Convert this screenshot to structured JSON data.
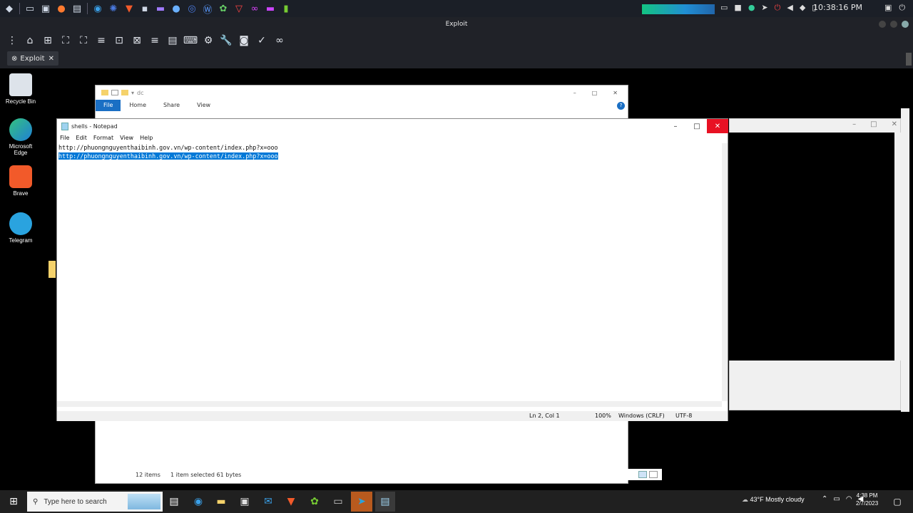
{
  "kali_panel": {
    "clock": "10:38:16 PM",
    "icons": [
      "kali-menu-icon",
      "workspace-icon",
      "files-icon",
      "firefox-icon",
      "terminal-icon",
      "edge-icon",
      "app-icon",
      "brave-icon",
      "app-icon",
      "app-icon",
      "app-icon",
      "app-icon",
      "app-icon",
      "app-icon",
      "app-icon"
    ]
  },
  "viewer": {
    "title": "Exploit",
    "tab_label": "Exploit",
    "tab_close": "✕"
  },
  "desktop_icons": [
    {
      "label": "Recycle Bin"
    },
    {
      "label": "Microsoft Edge"
    },
    {
      "label": "Brave"
    },
    {
      "label": "Telegram"
    }
  ],
  "explorer": {
    "path_text": "dc",
    "ribbon_tabs": [
      "File",
      "Home",
      "Share",
      "View"
    ],
    "status_items": "12 items",
    "status_selected": "1 item selected  61 bytes"
  },
  "notepad": {
    "title": "shells - Notepad",
    "menu": [
      "File",
      "Edit",
      "Format",
      "View",
      "Help"
    ],
    "lines": [
      "http://phuongnguyenthaibinh.gov.vn/wp-content/index.php?x=ooo",
      "http://phuongnguyenthaibinh.gov.vn/wp-content/index.php?x=ooo"
    ],
    "status": {
      "position": "Ln 2, Col 1",
      "zoom": "100%",
      "line_ending": "Windows (CRLF)",
      "encoding": "UTF-8"
    }
  },
  "taskbar": {
    "search_placeholder": "Type here to search",
    "weather": "43°F  Mostly cloudy",
    "time": "4:38 PM",
    "date": "2/7/2023"
  }
}
